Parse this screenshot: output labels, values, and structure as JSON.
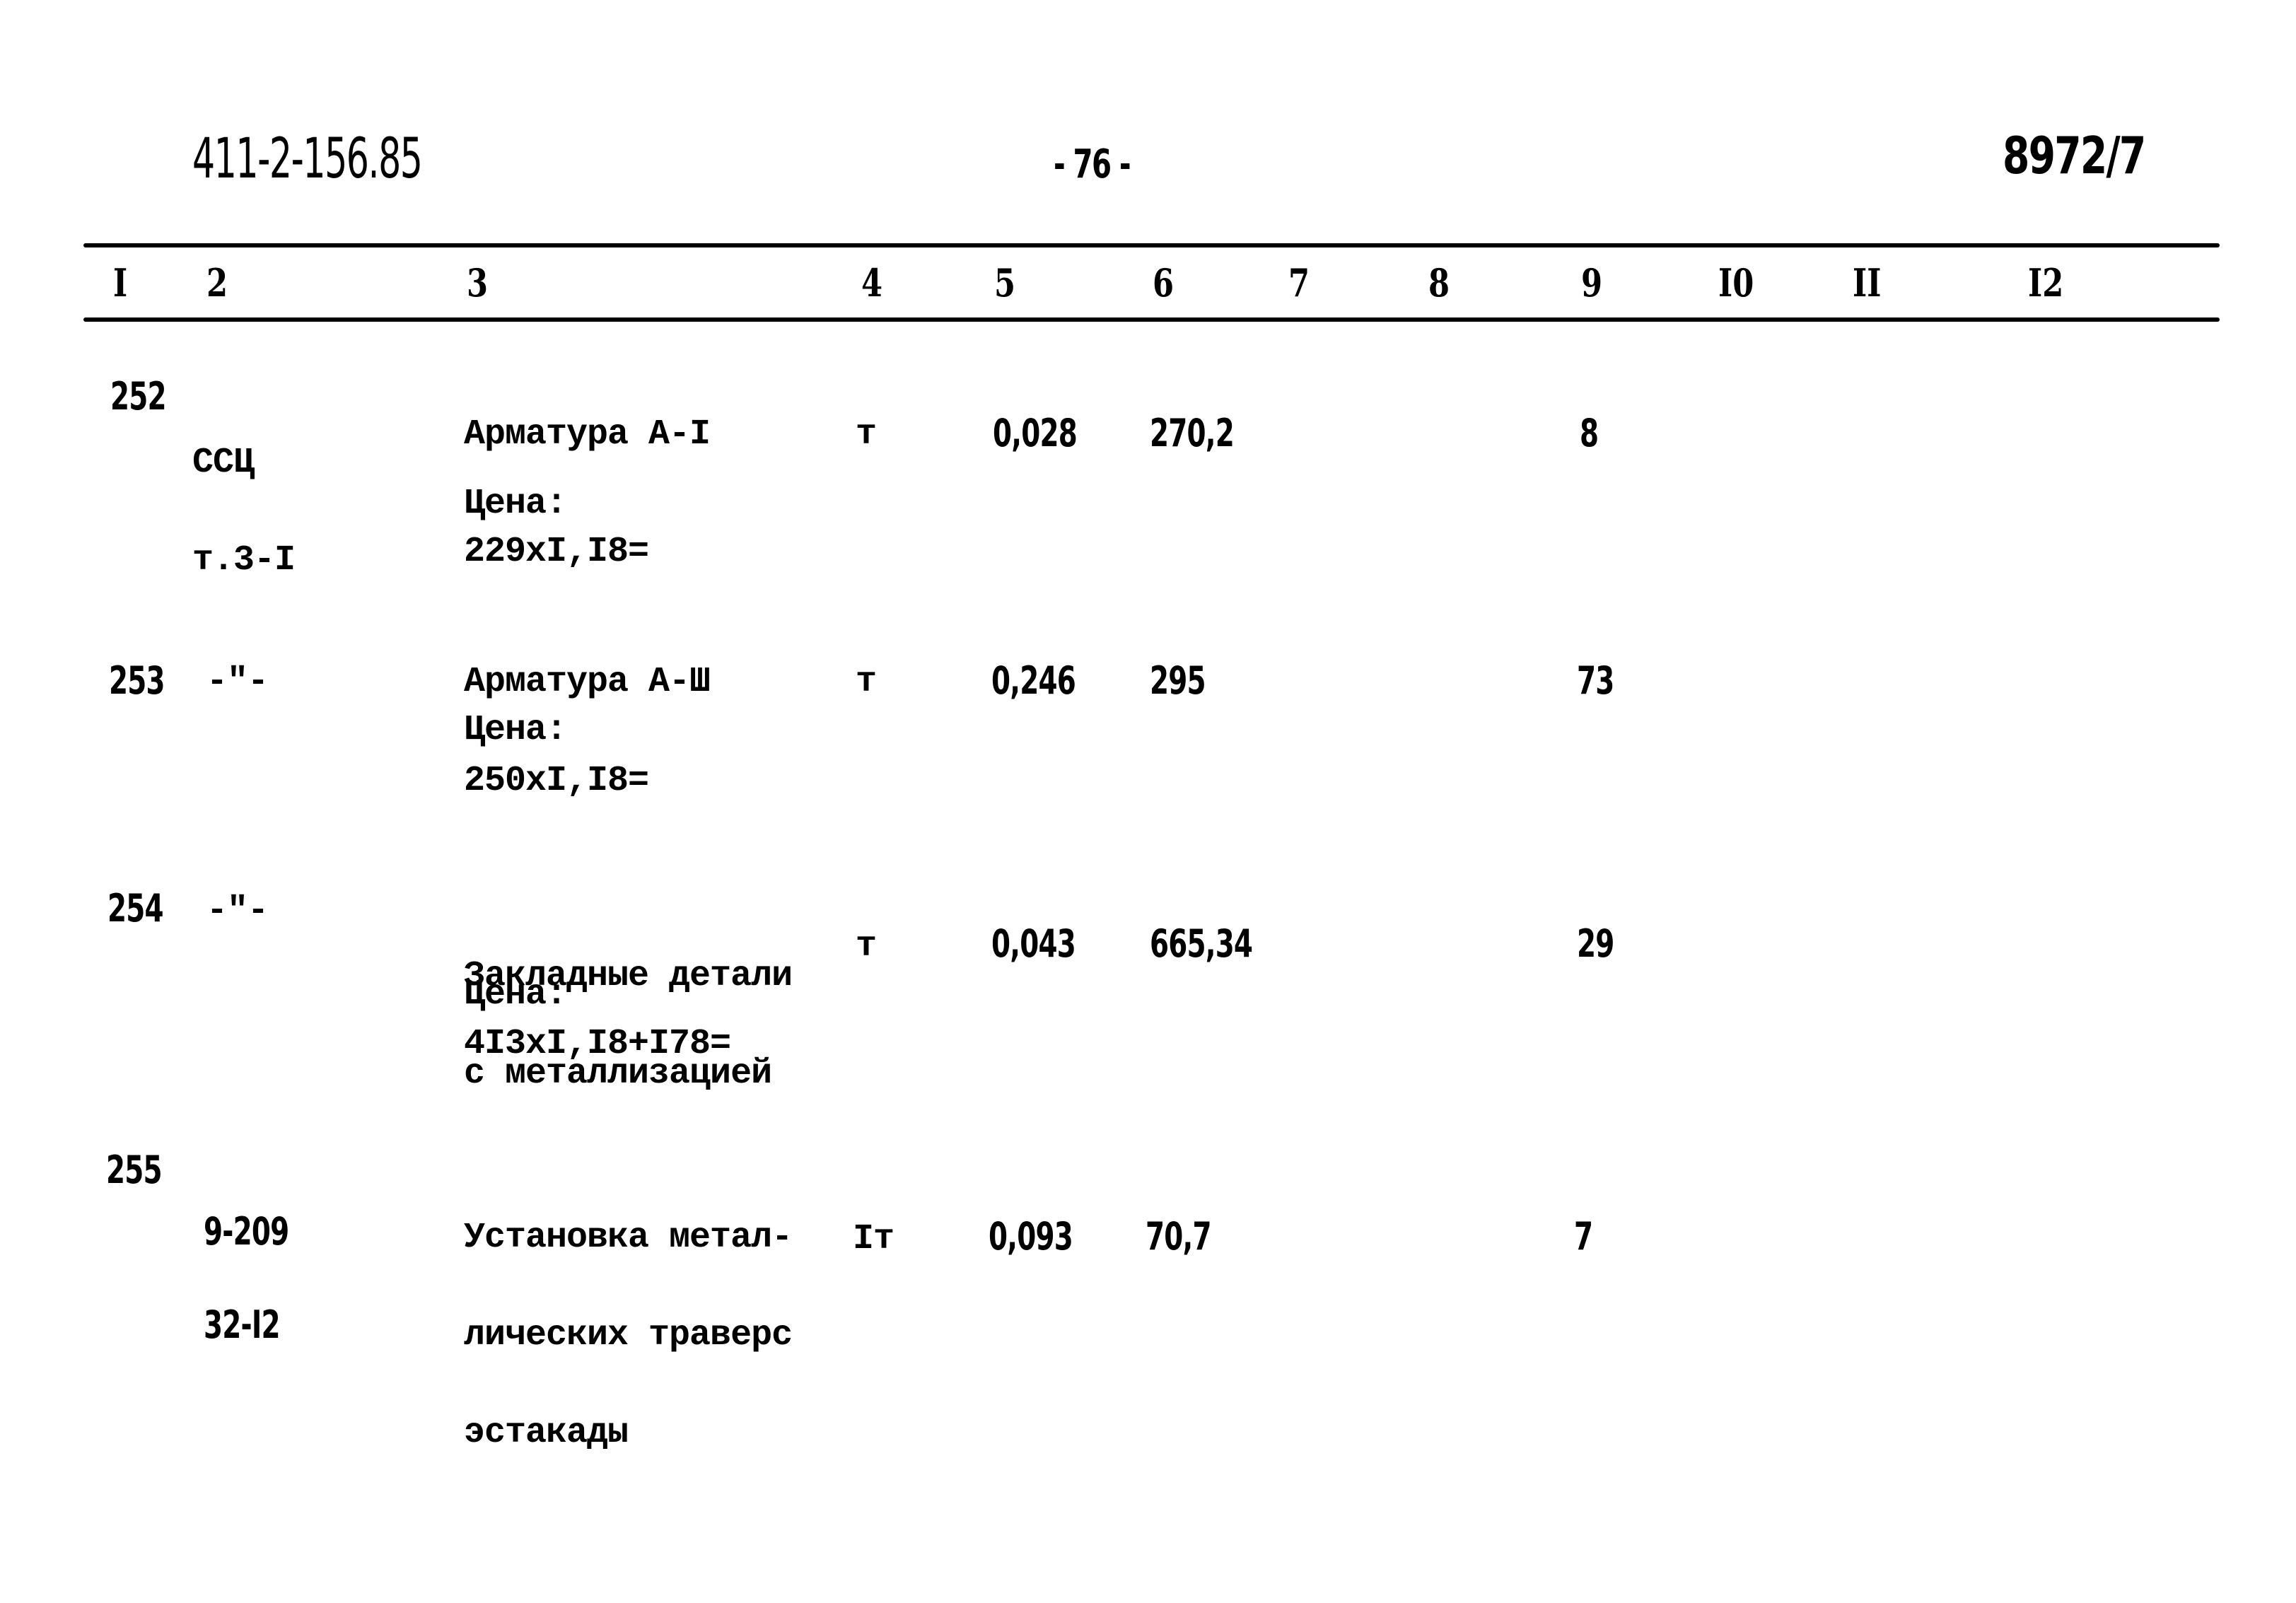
{
  "header": {
    "doc_code": "411-2-156.85",
    "page_number": "- 76 -",
    "sheet_ref": "8972/7"
  },
  "table": {
    "column_numbers": [
      "I",
      "2",
      "3",
      "4",
      "5",
      "6",
      "7",
      "8",
      "9",
      "I0",
      "II",
      "I2"
    ],
    "rows": [
      {
        "no": "252",
        "code_lines": [
          "ССЦ",
          "т.3-I"
        ],
        "desc_lines": [
          "Арматура А-I"
        ],
        "price_label": "Цена:",
        "price_formula": "229xI,I8=",
        "unit": "т",
        "qty": "0,028",
        "price": "270,2",
        "total": "8"
      },
      {
        "no": "253",
        "code_lines": [
          "-\"-"
        ],
        "desc_lines": [
          "Арматура А-Ш"
        ],
        "price_label": "Цена:",
        "price_formula": "250xI,I8=",
        "unit": "т",
        "qty": "0,246",
        "price": "295",
        "total": "73"
      },
      {
        "no": "254",
        "code_lines": [
          "-\"-"
        ],
        "desc_lines": [
          "Закладные детали",
          "с металлизацией"
        ],
        "price_label": "Цена:",
        "price_formula": "4I3xI,I8+I78=",
        "unit": "т",
        "qty": "0,043",
        "price": "665,34",
        "total": "29"
      },
      {
        "no": "255",
        "code_lines": [
          "9-209",
          "32-I2"
        ],
        "desc_lines": [
          "Установка метал-",
          "лических траверс",
          "эстакады"
        ],
        "price_label": "",
        "price_formula": "",
        "unit": "Iт",
        "qty": "0,093",
        "price": "70,7",
        "total": "7"
      }
    ]
  }
}
